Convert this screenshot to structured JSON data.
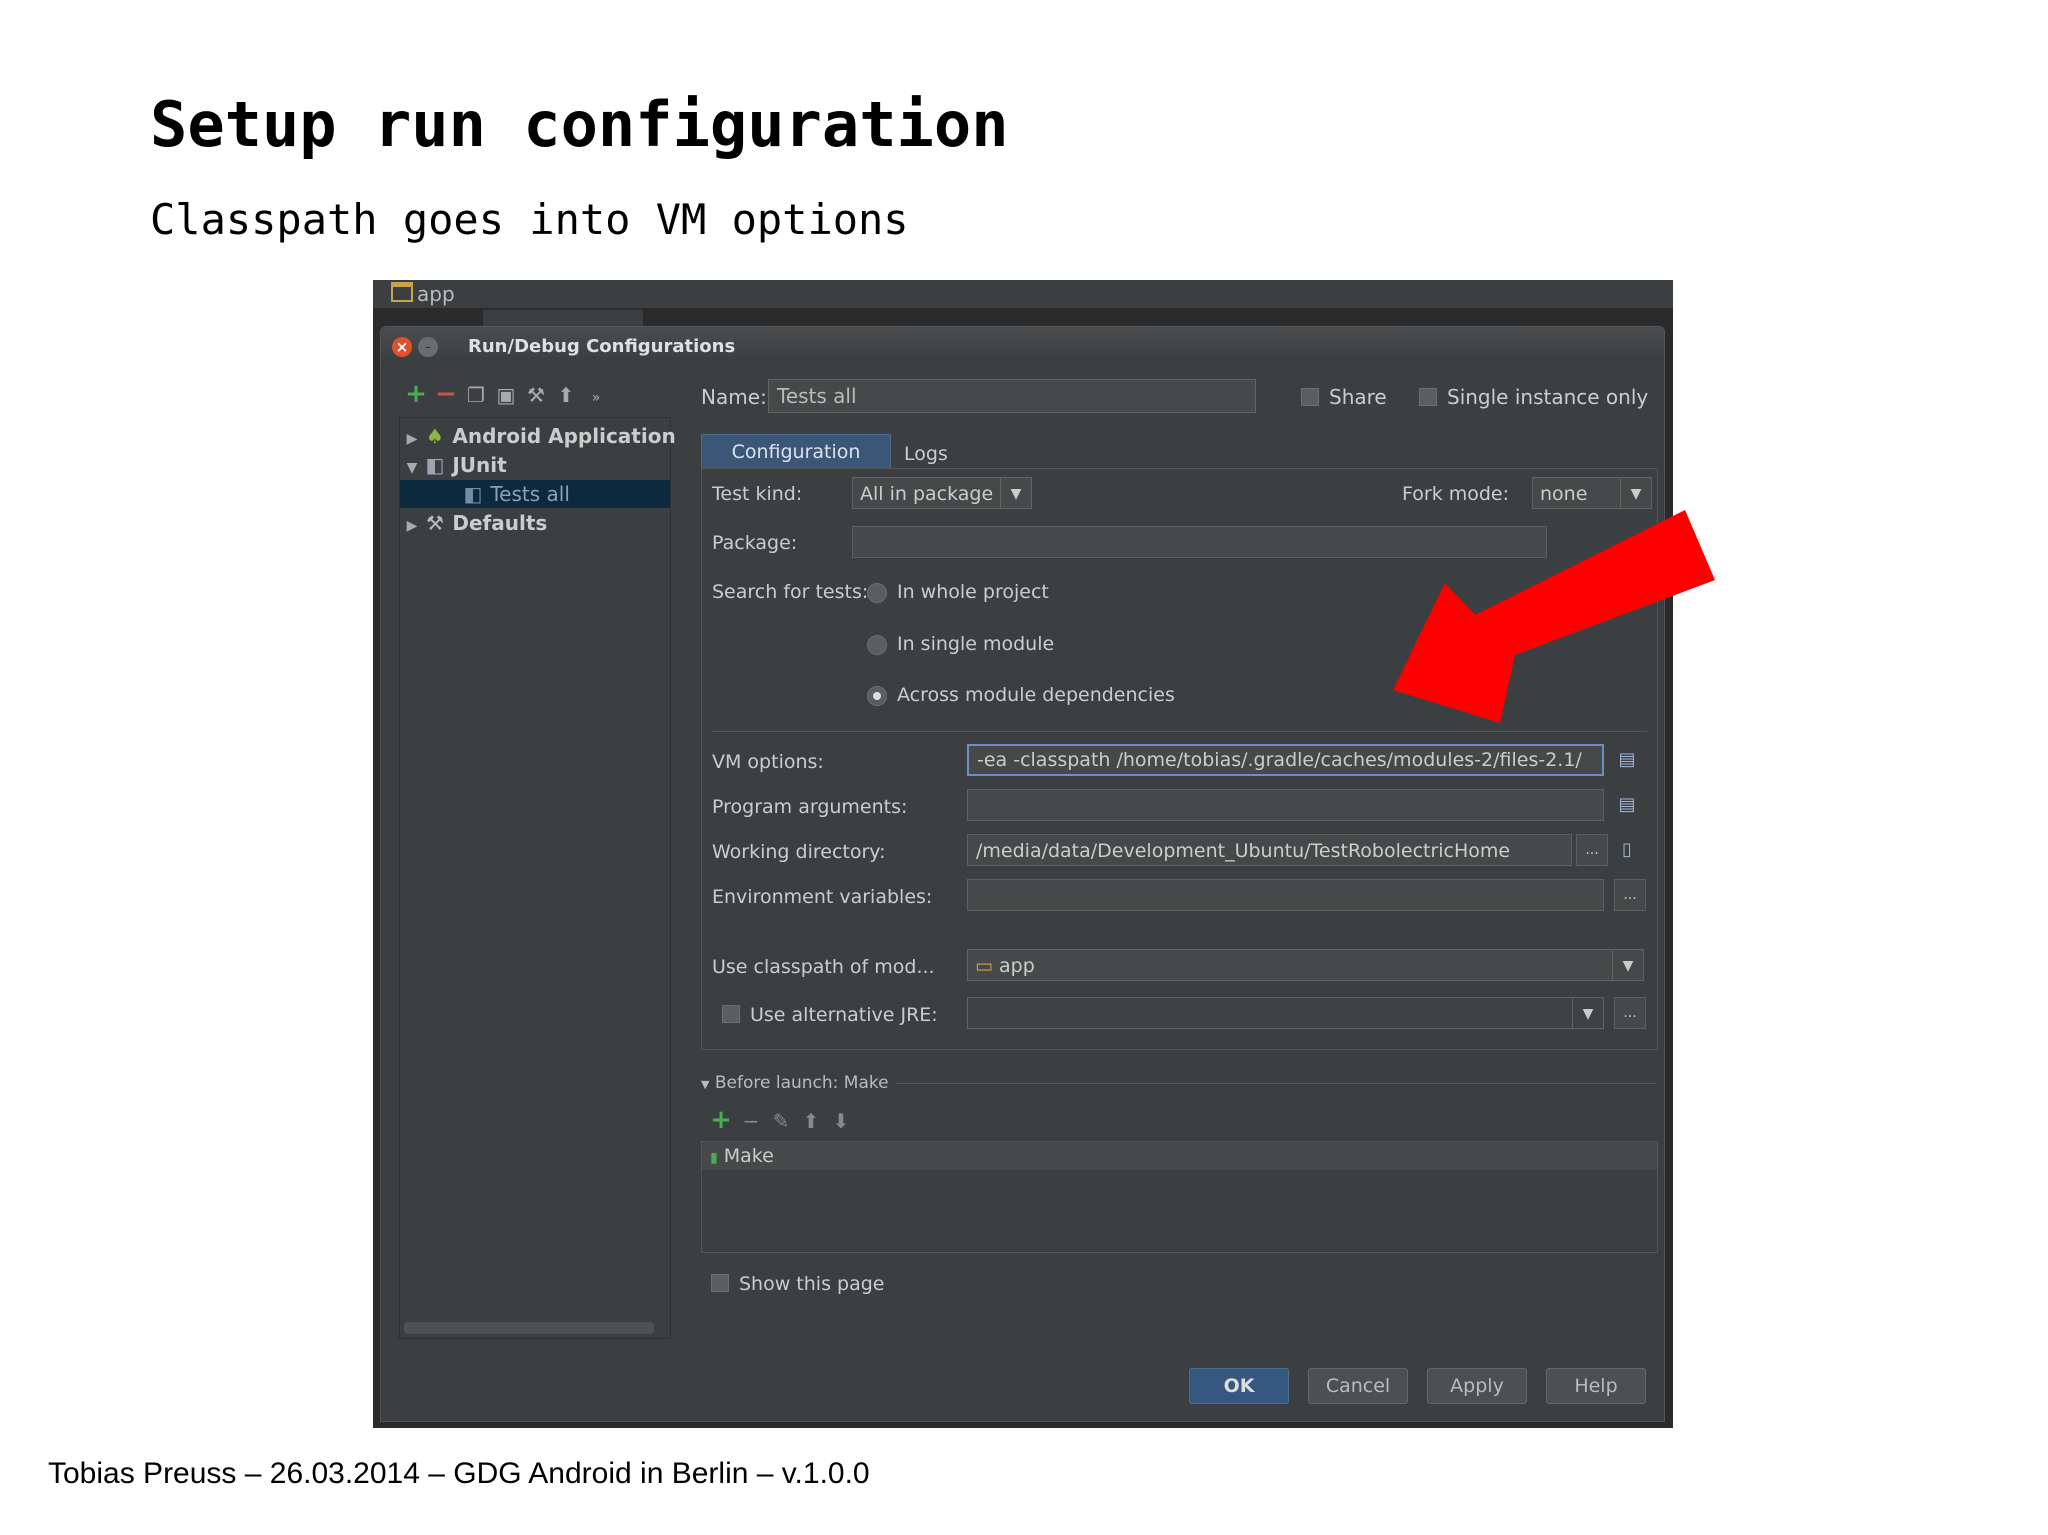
{
  "slide": {
    "title": "Setup run configuration",
    "subtitle": "Classpath goes into VM options",
    "footer": "Tobias Preuss – 26.03.2014 – GDG Android in Berlin – v.1.0.0"
  },
  "ide": {
    "breadcrumb": "app"
  },
  "dialog": {
    "title": "Run/Debug Configurations",
    "tree": [
      {
        "label": "Android Application",
        "icon": "android-icon",
        "expanded": false
      },
      {
        "label": "JUnit",
        "icon": "junit-icon",
        "expanded": true
      },
      {
        "label": "Tests all",
        "icon": "junit-test-icon",
        "selected": true
      },
      {
        "label": "Defaults",
        "icon": "wrench-icon",
        "expanded": false
      }
    ],
    "name_label": "Name:",
    "name_value": "Tests all",
    "share_label": "Share",
    "single_instance_label": "Single instance only",
    "tabs": {
      "configuration": "Configuration",
      "logs": "Logs"
    },
    "test_kind_label": "Test kind:",
    "test_kind_value": "All in package",
    "fork_mode_label": "Fork mode:",
    "fork_mode_value": "none",
    "package_label": "Package:",
    "package_value": "",
    "search_label": "Search for tests:",
    "search_options": [
      "In whole project",
      "In single module",
      "Across module dependencies"
    ],
    "search_selected": "Across module dependencies",
    "vm_options_label": "VM options:",
    "vm_options_value": "-ea -classpath /home/tobias/.gradle/caches/modules-2/files-2.1/",
    "program_args_label": "Program arguments:",
    "program_args_value": "",
    "working_dir_label": "Working directory:",
    "working_dir_value": "/media/data/Development_Ubuntu/TestRobolectricHome",
    "env_vars_label": "Environment variables:",
    "env_vars_value": "",
    "classpath_module_label": "Use classpath of mod...",
    "classpath_module_value": "app",
    "alt_jre_label": "Use alternative JRE:",
    "alt_jre_value": "",
    "before_launch_label": "Before launch: Make",
    "before_launch_items": [
      "Make"
    ],
    "show_page_label": "Show this page",
    "buttons": {
      "ok": "OK",
      "cancel": "Cancel",
      "apply": "Apply",
      "help": "Help"
    },
    "ellipsis": "...",
    "dropdown_glyph": "▼"
  },
  "colors": {
    "highlight_arrow": "#ff0000",
    "accent": "#365880"
  }
}
